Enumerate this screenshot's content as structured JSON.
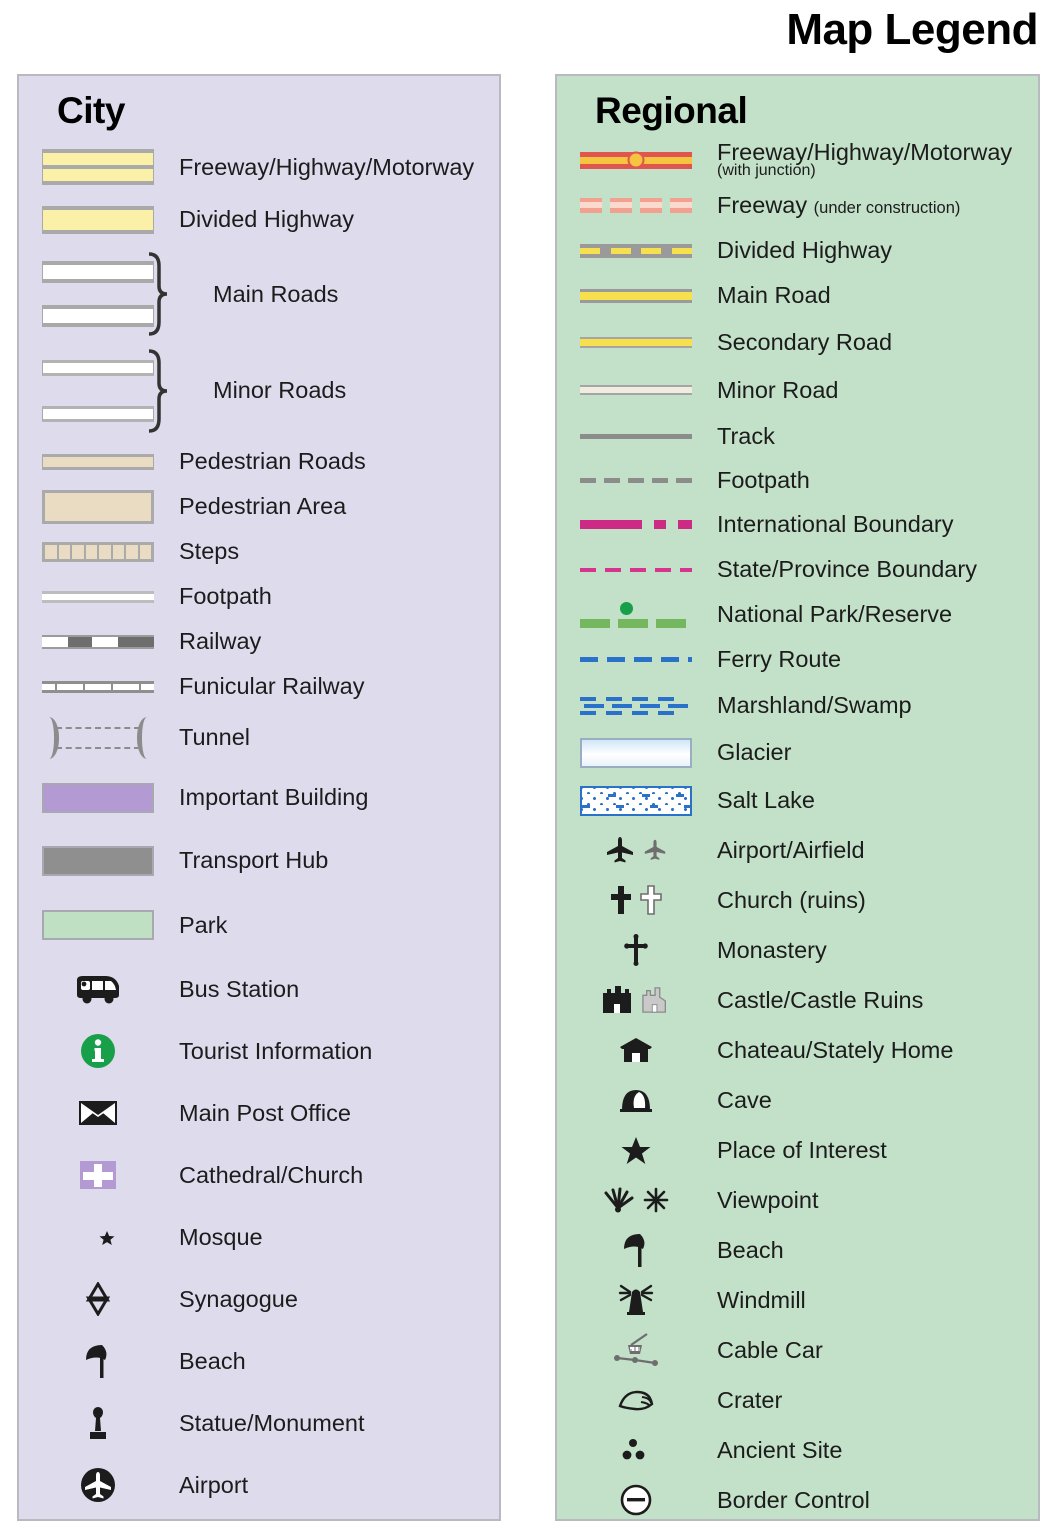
{
  "title": "Map Legend",
  "panels": {
    "city": {
      "heading": "City",
      "bg_color": "#dedcec",
      "items": [
        {
          "label": "Freeway/Highway/Motorway",
          "symbol": "city-freeway"
        },
        {
          "label": "Divided Highway",
          "symbol": "city-divided-highway"
        },
        {
          "label": "Main Roads",
          "symbol": "city-main-roads-pair"
        },
        {
          "label": "Minor Roads",
          "symbol": "city-minor-roads-pair"
        },
        {
          "label": "Pedestrian Roads",
          "symbol": "city-pedestrian-road"
        },
        {
          "label": "Pedestrian Area",
          "symbol": "city-pedestrian-area"
        },
        {
          "label": "Steps",
          "symbol": "city-steps"
        },
        {
          "label": "Footpath",
          "symbol": "city-footpath"
        },
        {
          "label": "Railway",
          "symbol": "city-railway"
        },
        {
          "label": "Funicular Railway",
          "symbol": "city-funicular-railway"
        },
        {
          "label": "Tunnel",
          "symbol": "city-tunnel"
        },
        {
          "label": "Important Building",
          "symbol": "city-important-building"
        },
        {
          "label": "Transport Hub",
          "symbol": "city-transport-hub"
        },
        {
          "label": "Park",
          "symbol": "city-park"
        },
        {
          "label": "Bus Station",
          "symbol": "bus-icon"
        },
        {
          "label": "Tourist Information",
          "symbol": "info-icon"
        },
        {
          "label": "Main Post Office",
          "symbol": "envelope-icon"
        },
        {
          "label": "Cathedral/Church",
          "symbol": "church-cross-icon"
        },
        {
          "label": "Mosque",
          "symbol": "crescent-star-icon"
        },
        {
          "label": "Synagogue",
          "symbol": "star-of-david-icon"
        },
        {
          "label": "Beach",
          "symbol": "beach-umbrella-icon"
        },
        {
          "label": "Statue/Monument",
          "symbol": "statue-icon"
        },
        {
          "label": "Airport",
          "symbol": "airport-circle-icon"
        }
      ]
    },
    "regional": {
      "heading": "Regional",
      "bg_color": "#c3e0c8",
      "items": [
        {
          "label": "Freeway/Highway/Motorway",
          "sub": "(with junction)",
          "sub_block": true,
          "symbol": "regional-freeway-junction"
        },
        {
          "label": "Freeway",
          "sub": "(under construction)",
          "symbol": "regional-freeway-construction"
        },
        {
          "label": "Divided Highway",
          "symbol": "regional-divided-highway"
        },
        {
          "label": "Main Road",
          "symbol": "regional-main-road"
        },
        {
          "label": "Secondary Road",
          "symbol": "regional-secondary-road"
        },
        {
          "label": "Minor Road",
          "symbol": "regional-minor-road"
        },
        {
          "label": "Track",
          "symbol": "regional-track"
        },
        {
          "label": "Footpath",
          "symbol": "regional-footpath"
        },
        {
          "label": "International Boundary",
          "symbol": "regional-international-boundary"
        },
        {
          "label": "State/Province Boundary",
          "symbol": "regional-state-boundary"
        },
        {
          "label": "National Park/Reserve",
          "symbol": "regional-national-park"
        },
        {
          "label": "Ferry Route",
          "symbol": "regional-ferry-route"
        },
        {
          "label": "Marshland/Swamp",
          "symbol": "regional-marshland"
        },
        {
          "label": "Glacier",
          "symbol": "regional-glacier"
        },
        {
          "label": "Salt Lake",
          "symbol": "regional-salt-lake"
        },
        {
          "label": "Airport/Airfield",
          "symbol": "airplane-pair-icon"
        },
        {
          "label": "Church (ruins)",
          "symbol": "cross-pair-icon"
        },
        {
          "label": "Monastery",
          "symbol": "monastery-cross-icon"
        },
        {
          "label": "Castle/Castle Ruins",
          "symbol": "castle-pair-icon"
        },
        {
          "label": "Chateau/Stately Home",
          "symbol": "chateau-icon"
        },
        {
          "label": "Cave",
          "symbol": "cave-icon"
        },
        {
          "label": "Place of Interest",
          "symbol": "star-icon"
        },
        {
          "label": "Viewpoint",
          "symbol": "viewpoint-pair-icon"
        },
        {
          "label": "Beach",
          "symbol": "beach-umbrella-icon"
        },
        {
          "label": "Windmill",
          "symbol": "windmill-icon"
        },
        {
          "label": "Cable Car",
          "symbol": "cable-car-icon"
        },
        {
          "label": "Crater",
          "symbol": "crater-icon"
        },
        {
          "label": "Ancient Site",
          "symbol": "ancient-site-icon"
        },
        {
          "label": "Border Control",
          "symbol": "border-control-icon"
        }
      ]
    }
  },
  "colors": {
    "city_panel": "#dedcec",
    "regional_panel": "#c3e0c8",
    "highway_yellow": "#faf0a8",
    "road_yellow": "#f7e04e",
    "freeway_red": "#e0554e",
    "junction_amber": "#f5c542",
    "pedestrian_tan": "#eadcc2",
    "building_purple": "#b49ad3",
    "hub_gray": "#8f8f8f",
    "park_green": "#bfe0c2",
    "boundary_magenta": "#cc2a84",
    "ferry_blue": "#2a72c9",
    "national_park_green": "#74b75e",
    "info_green": "#17a049"
  }
}
